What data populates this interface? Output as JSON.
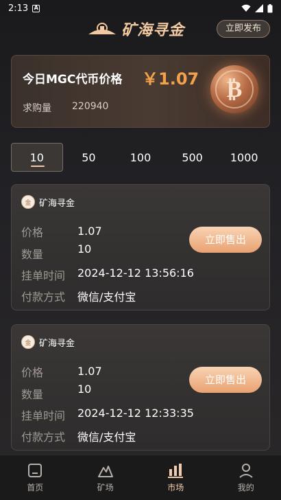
{
  "status": {
    "time": "2:13",
    "notification_icon": "A"
  },
  "header": {
    "title": "矿海寻金",
    "publish_label": "立即发布"
  },
  "price_card": {
    "label": "今日MGC代币价格",
    "price": "￥1.07",
    "buy_label": "求购量",
    "buy_value": "220940",
    "coin_icon": "bitcoin-icon"
  },
  "qty_tabs": [
    "10",
    "50",
    "100",
    "500",
    "1000"
  ],
  "orders": [
    {
      "seller": "矿海寻金",
      "price_label": "价格",
      "price": "1.07",
      "qty_label": "数量",
      "qty": "10",
      "time_label": "挂单时间",
      "time": "2024-12-12 13:56:16",
      "pay_label": "付款方式",
      "pay": "微信/支付宝",
      "sell_label": "立即售出"
    },
    {
      "seller": "矿海寻金",
      "price_label": "价格",
      "price": "1.07",
      "qty_label": "数量",
      "qty": "10",
      "time_label": "挂单时间",
      "time": "2024-12-12 12:33:35",
      "pay_label": "付款方式",
      "pay": "微信/支付宝",
      "sell_label": "立即售出"
    }
  ],
  "tabbar": [
    {
      "label": "首页",
      "icon": "home-icon"
    },
    {
      "label": "矿场",
      "icon": "mine-icon"
    },
    {
      "label": "市场",
      "icon": "market-icon"
    },
    {
      "label": "我的",
      "icon": "profile-icon"
    }
  ],
  "colors": {
    "accent": "#f3a14b",
    "button": "#e9a171",
    "active_tab": "#f0cdb1"
  }
}
